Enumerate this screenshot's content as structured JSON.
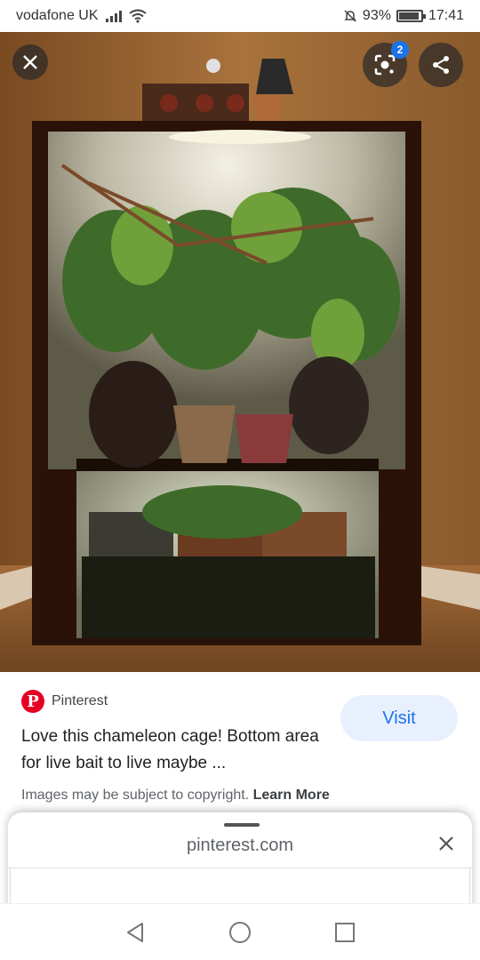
{
  "status": {
    "carrier": "vodafone UK",
    "battery_pct": "93%",
    "battery_level": 0.93,
    "time": "17:41"
  },
  "image": {
    "lens_badge_count": "2"
  },
  "result": {
    "source": "Pinterest",
    "caption": "Love this chameleon cage! Bottom area for live bait to live maybe ...",
    "visit_label": "Visit",
    "copyright_text": "Images may be subject to copyright.",
    "learn_more": "Learn More"
  },
  "sheet": {
    "url": "pinterest.com"
  },
  "icons": {
    "close": "close-icon",
    "lens": "lens-icon",
    "share": "share-icon",
    "back": "back-triangle-icon",
    "home": "home-circle-icon",
    "recents": "recents-square-icon"
  },
  "colors": {
    "accent": "#1a73e8",
    "visit_bg": "#e8f0fe",
    "pinterest_red": "#e60023"
  }
}
